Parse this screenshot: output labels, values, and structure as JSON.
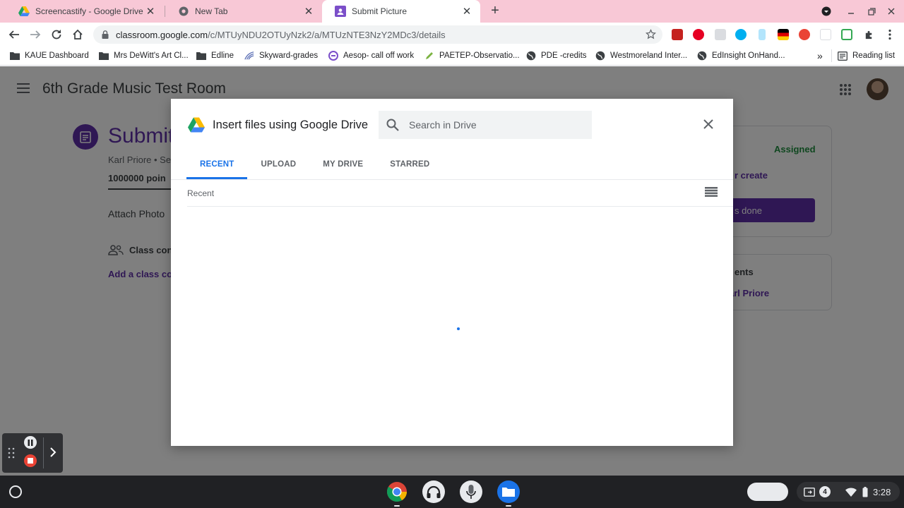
{
  "browser": {
    "tabs": [
      {
        "title": "Screencastify - Google Drive",
        "icon": "google-drive-icon"
      },
      {
        "title": "New Tab",
        "icon": "chrome-icon"
      },
      {
        "title": "Submit Picture",
        "icon": "google-classroom-icon",
        "active": true
      }
    ],
    "new_tab_symbol": "+",
    "url_host": "classroom.google.com",
    "url_path": "/c/MTUyNDU2OTUyNzk2/a/MTUzNTE3NzY2MDc3/details",
    "bookmarks": [
      {
        "label": "KAUE Dashboard",
        "icon": "folder-icon"
      },
      {
        "label": "Mrs DeWitt's Art Cl...",
        "icon": "folder-icon"
      },
      {
        "label": "Edline",
        "icon": "folder-icon"
      },
      {
        "label": "Skyward-grades",
        "icon": "skyward-icon"
      },
      {
        "label": "Aesop- call off work",
        "icon": "aesop-icon"
      },
      {
        "label": "PAETEP-Observatio...",
        "icon": "pencil-icon"
      },
      {
        "label": "PDE -credits",
        "icon": "globe-icon"
      },
      {
        "label": "Westmoreland Inter...",
        "icon": "globe-icon"
      },
      {
        "label": "EdInsight OnHand...",
        "icon": "globe-icon"
      }
    ],
    "bookmarks_overflow": "»",
    "reading_list": "Reading list"
  },
  "classroom": {
    "room_title": "6th Grade Music Test Room",
    "assignment_title": "Submit",
    "teacher_meta": "Karl Priore • Se",
    "points": "1000000 poin",
    "attach_label": "Attach Photo",
    "class_comments_label": "Class con",
    "add_comment_label": "Add a class co",
    "status": "Assigned",
    "create_link": "r create",
    "done_button": "s done",
    "private_comments_label": "ents",
    "private_comment_name": "arl Priore"
  },
  "dialog": {
    "title": "Insert files using Google Drive",
    "search_placeholder": "Search in Drive",
    "tabs": [
      "RECENT",
      "UPLOAD",
      "MY DRIVE",
      "STARRED"
    ],
    "active_tab": "RECENT",
    "section_label": "Recent"
  },
  "system": {
    "notification_count": "4",
    "clock": "3:28"
  },
  "colors": {
    "classroom_purple": "#5f2fa8",
    "accent_blue": "#1a73e8",
    "assigned_green": "#1e8e3e",
    "tab_strip_pink": "#f8c8d6"
  }
}
